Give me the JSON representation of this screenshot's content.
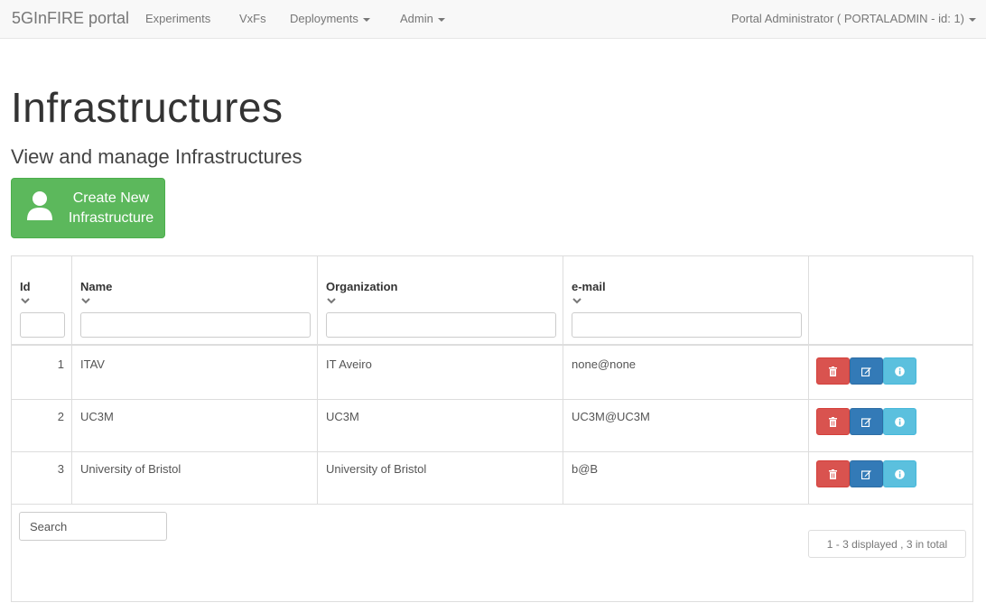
{
  "navbar": {
    "brand": "5GInFIRE portal",
    "items": [
      {
        "label": "Experiments",
        "dropdown": false
      },
      {
        "label": "VxFs",
        "dropdown": false
      },
      {
        "label": "Deployments",
        "dropdown": true
      },
      {
        "label": "Admin",
        "dropdown": true
      }
    ],
    "user": "Portal Administrator ( PORTALADMIN - id: 1)"
  },
  "page": {
    "title": "Infrastructures",
    "subtitle": "View and manage Infrastructures",
    "create_button": {
      "line1": "Create New",
      "line2": "Infrastructure",
      "icon": "user-icon"
    }
  },
  "table": {
    "columns": [
      "Id",
      "Name",
      "Organization",
      "e-mail"
    ],
    "rows": [
      {
        "id": "1",
        "name": "ITAV",
        "organization": "IT Aveiro",
        "email": "none@none"
      },
      {
        "id": "2",
        "name": "UC3M",
        "organization": "UC3M",
        "email": "UC3M@UC3M"
      },
      {
        "id": "3",
        "name": "University of Bristol",
        "organization": "University of Bristol",
        "email": "b@B"
      }
    ],
    "actions": [
      {
        "name": "delete",
        "icon": "trash-icon",
        "color": "#d9534f"
      },
      {
        "name": "edit",
        "icon": "edit-icon",
        "color": "#337ab7"
      },
      {
        "name": "info",
        "icon": "info-icon",
        "color": "#5bc0de"
      }
    ]
  },
  "search": {
    "placeholder": "Search"
  },
  "pagination": {
    "summary": "1 - 3 displayed , 3 in total"
  },
  "colors": {
    "success": "#5cb85c",
    "danger": "#d9534f",
    "primary": "#337ab7",
    "info": "#5bc0de",
    "navbar_bg": "#f8f8f8"
  }
}
